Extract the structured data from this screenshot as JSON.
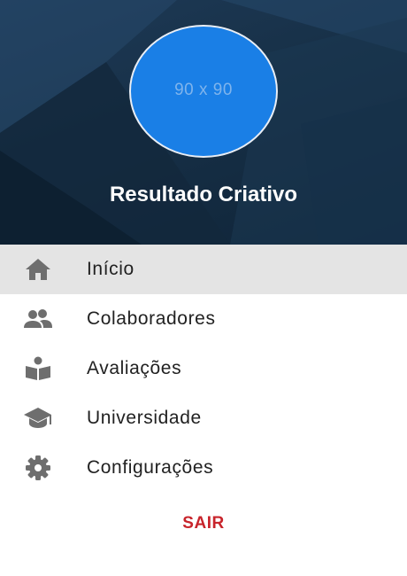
{
  "header": {
    "avatar_placeholder": "90 x 90",
    "title": "Resultado Criativo"
  },
  "menu": {
    "items": [
      {
        "label": "Início",
        "icon": "home-icon",
        "active": true
      },
      {
        "label": "Colaboradores",
        "icon": "people-icon",
        "active": false
      },
      {
        "label": "Avaliações",
        "icon": "book-reader-icon",
        "active": false
      },
      {
        "label": "Universidade",
        "icon": "graduation-cap-icon",
        "active": false
      },
      {
        "label": "Configurações",
        "icon": "gear-icon",
        "active": false
      }
    ]
  },
  "logout_label": "SAIR",
  "colors": {
    "accent": "#1a7fe6",
    "logout": "#c8242b",
    "active_bg": "#e4e4e4",
    "icon": "#6e6e6e"
  }
}
